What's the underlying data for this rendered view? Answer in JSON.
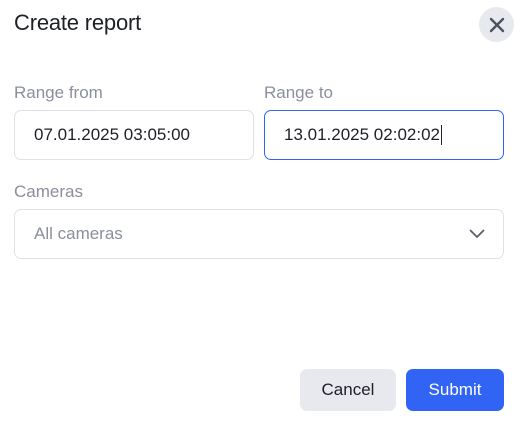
{
  "dialog": {
    "title": "Create report"
  },
  "range_from": {
    "label": "Range from",
    "value": "07.01.2025 03:05:00"
  },
  "range_to": {
    "label": "Range to",
    "value": "13.01.2025 02:02:02"
  },
  "cameras": {
    "label": "Cameras",
    "selected": "All cameras"
  },
  "actions": {
    "cancel_label": "Cancel",
    "submit_label": "Submit"
  },
  "icons": {
    "close": "close-icon",
    "dropdown": "chevron-down-icon"
  },
  "colors": {
    "accent": "#3164f4",
    "secondary_button": "#e8e9ee",
    "muted_text": "#8b8f9c",
    "border": "#dfe1e6"
  }
}
